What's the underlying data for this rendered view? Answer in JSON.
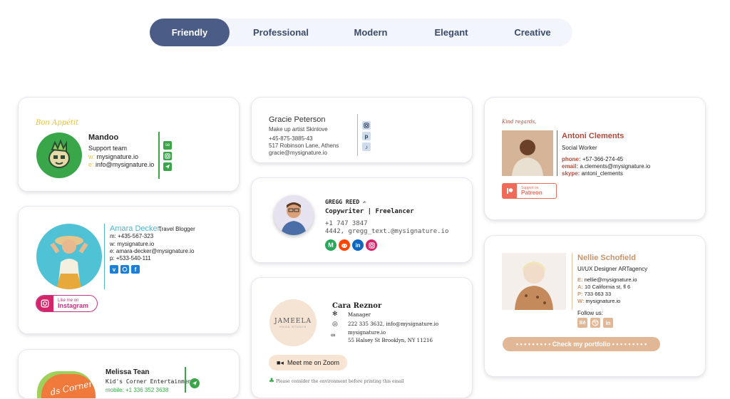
{
  "tabs": [
    {
      "label": "Friendly",
      "active": true
    },
    {
      "label": "Professional",
      "active": false
    },
    {
      "label": "Modern",
      "active": false
    },
    {
      "label": "Elegant",
      "active": false
    },
    {
      "label": "Creative",
      "active": false
    }
  ],
  "mandoo": {
    "greeting": "Bon Appétit",
    "name": "Mandoo",
    "role": "Support team",
    "w_label": "w:",
    "web": "mysignature.io",
    "e_label": "e:",
    "email": "info@mysignature.io",
    "icons": [
      "se-icon",
      "instagram-icon",
      "telegram-icon"
    ]
  },
  "amara": {
    "name": "Amara Decker,",
    "role": "Travel Blogger",
    "phone": "m: +435-567-323",
    "web": "w: mysignature.io",
    "email": "e: amara-decker@mysignature.io",
    "fax": "p: +533-540-111",
    "badge_small": "Like me on",
    "badge_big": "Instagram",
    "icons": [
      "vimeo-icon",
      "vk-icon",
      "facebook-icon"
    ]
  },
  "melissa": {
    "logo_text": "ds Corner!",
    "name": "Melissa Tean",
    "role": "Kid's Corner Entertainment",
    "phone": "mobile: +1 336 352 3638"
  },
  "gracie": {
    "name": "Gracie Peterson",
    "role": "Make up artist Skinlove",
    "phone": "+45-875-3885-43",
    "address": "517 Robinson Lane, Athens",
    "email": "gracie@mysignature.io"
  },
  "gregg": {
    "name": "GREGG REED",
    "role": "Copywriter | Freelancer",
    "phone": "+1 747 3847",
    "address": "4442, gregg_text.@mysignature.io",
    "icons": [
      "medium-icon",
      "reddit-icon",
      "linkedin-icon",
      "instagram-icon"
    ]
  },
  "cara": {
    "logo_main": "JAMEELA",
    "logo_sub": "YOGA STUDIO",
    "name": "Cara Reznor",
    "role": "Manager",
    "phone": "222 335 3632, info@mysignature.io",
    "web": "mysignature.io",
    "address": "55 Halsey St Brooklyn, NY 11216",
    "zoom": "Meet me on Zoom",
    "eco": "Please consider the environment before printing this email"
  },
  "antoni": {
    "greeting": "Kind regards,",
    "name": "Antoni Clements",
    "role": "Social Worker",
    "phone_label": "phone:",
    "phone": "+57-366-274-45",
    "email_label": "email:",
    "email": "a.clements@mysignature.io",
    "skype_label": "skype:",
    "skype": "antoni_clements",
    "patreon_small": "Support on",
    "patreon_big": "Patreon"
  },
  "nellie": {
    "name": "Nellie Schofield",
    "role": "UI/UX Designer ARTagency",
    "e_label": "E:",
    "email": "nellie@mysignature.io",
    "a_label": "A:",
    "address": "10 California st, fl 6",
    "p_label": "P:",
    "phone": "733 663 33",
    "w_label": "W:",
    "web": "mysignature.io",
    "follow": "Follow us:",
    "portfolio": "• • • • • • • • • Check my portfolio • • • • • • • • •",
    "icons": [
      "behance-icon",
      "dribbble-icon",
      "linkedin-icon"
    ]
  },
  "colors": {
    "active_tab": "#4b5d86",
    "tab_bg": "#f2f5fb",
    "green": "#3aa64a",
    "amara_teal": "#4fb6c9",
    "antoni_red": "#b24a3a",
    "nellie_brown": "#c9936a"
  }
}
